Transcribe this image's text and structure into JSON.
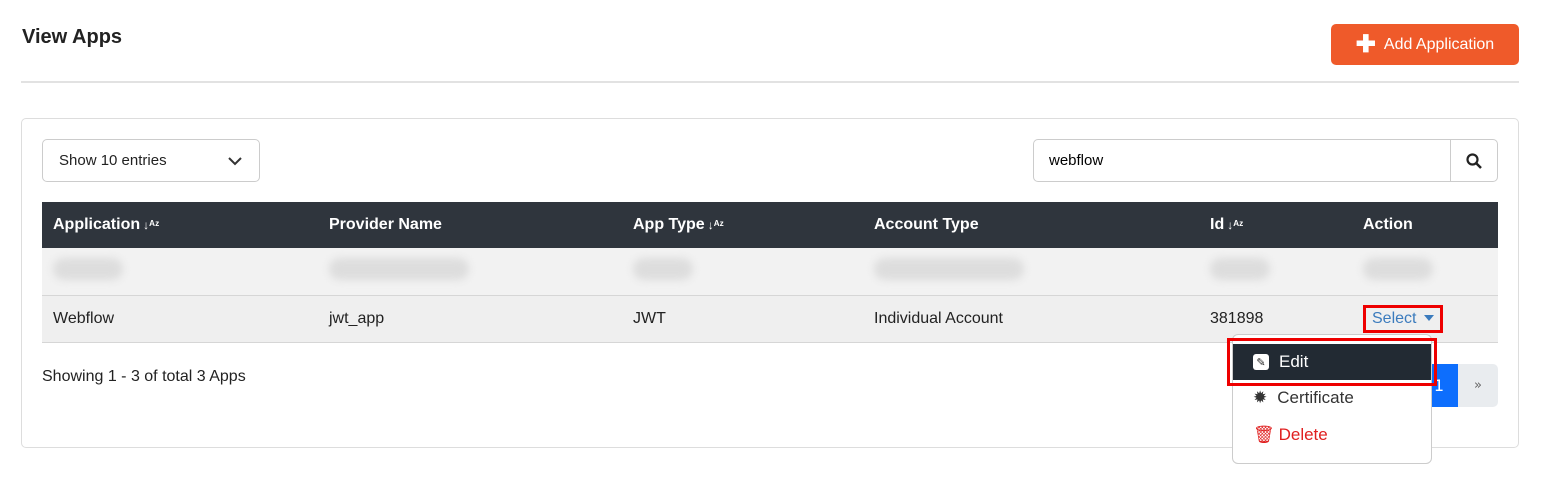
{
  "header": {
    "title": "View Apps",
    "add_label": "Add Application"
  },
  "controls": {
    "entries": "Show 10 entries",
    "search_value": "webflow"
  },
  "table": {
    "columns": [
      "Application",
      "Provider Name",
      "App Type",
      "Account Type",
      "Id",
      "Action"
    ],
    "rows": [
      {
        "application": "Webflow",
        "provider": "jwt_app",
        "type": "JWT",
        "account": "Individual Account",
        "id": "381898",
        "action": "Select"
      }
    ]
  },
  "footer": {
    "info": "Showing 1 - 3 of total 3 Apps",
    "page": "1",
    "next": "»"
  },
  "menu": {
    "edit": "Edit",
    "certificate": "Certificate",
    "delete": "Delete"
  },
  "colors": {
    "accent": "#ef5a2a",
    "header": "#2f353d",
    "link": "#3b7bbd",
    "danger": "#e02020",
    "highlight": "#ee0000"
  }
}
